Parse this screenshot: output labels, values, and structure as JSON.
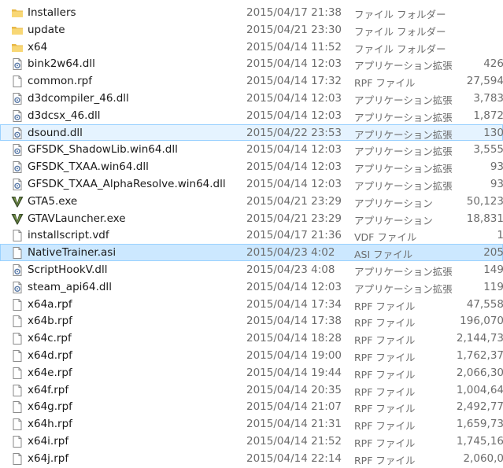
{
  "files": [
    {
      "name": "Installers",
      "date": "2015/04/17 21:38",
      "type": "ファイル フォルダー",
      "size": "",
      "icon": "folder-icon"
    },
    {
      "name": "update",
      "date": "2015/04/21 23:30",
      "type": "ファイル フォルダー",
      "size": "",
      "icon": "folder-icon"
    },
    {
      "name": "x64",
      "date": "2015/04/14 11:52",
      "type": "ファイル フォルダー",
      "size": "",
      "icon": "folder-icon"
    },
    {
      "name": "bink2w64.dll",
      "date": "2015/04/14 12:03",
      "type": "アプリケーション拡張",
      "size": "426",
      "icon": "dll-icon"
    },
    {
      "name": "common.rpf",
      "date": "2015/04/14 17:32",
      "type": "RPF ファイル",
      "size": "27,594",
      "icon": "file-icon"
    },
    {
      "name": "d3dcompiler_46.dll",
      "date": "2015/04/14 12:03",
      "type": "アプリケーション拡張",
      "size": "3,783",
      "icon": "dll-icon"
    },
    {
      "name": "d3dcsx_46.dll",
      "date": "2015/04/14 12:03",
      "type": "アプリケーション拡張",
      "size": "1,872",
      "icon": "dll-icon"
    },
    {
      "name": "dsound.dll",
      "date": "2015/04/22 23:53",
      "type": "アプリケーション拡張",
      "size": "130",
      "icon": "dll-icon",
      "state": "hot"
    },
    {
      "name": "GFSDK_ShadowLib.win64.dll",
      "date": "2015/04/14 12:03",
      "type": "アプリケーション拡張",
      "size": "3,555",
      "icon": "dll-icon"
    },
    {
      "name": "GFSDK_TXAA.win64.dll",
      "date": "2015/04/14 12:03",
      "type": "アプリケーション拡張",
      "size": "93",
      "icon": "dll-icon"
    },
    {
      "name": "GFSDK_TXAA_AlphaResolve.win64.dll",
      "date": "2015/04/14 12:03",
      "type": "アプリケーション拡張",
      "size": "93",
      "icon": "dll-icon"
    },
    {
      "name": "GTA5.exe",
      "date": "2015/04/21 23:29",
      "type": "アプリケーション",
      "size": "50,123",
      "icon": "gta-v-icon"
    },
    {
      "name": "GTAVLauncher.exe",
      "date": "2015/04/21 23:29",
      "type": "アプリケーション",
      "size": "18,831",
      "icon": "gta-v-icon"
    },
    {
      "name": "installscript.vdf",
      "date": "2015/04/17 21:36",
      "type": "VDF ファイル",
      "size": "1",
      "icon": "file-icon"
    },
    {
      "name": "NativeTrainer.asi",
      "date": "2015/04/23 4:02",
      "type": "ASI ファイル",
      "size": "205",
      "icon": "file-icon",
      "state": "sel"
    },
    {
      "name": "ScriptHookV.dll",
      "date": "2015/04/23 4:08",
      "type": "アプリケーション拡張",
      "size": "149",
      "icon": "dll-icon"
    },
    {
      "name": "steam_api64.dll",
      "date": "2015/04/14 12:03",
      "type": "アプリケーション拡張",
      "size": "119",
      "icon": "dll-icon"
    },
    {
      "name": "x64a.rpf",
      "date": "2015/04/14 17:34",
      "type": "RPF ファイル",
      "size": "47,558",
      "icon": "file-icon"
    },
    {
      "name": "x64b.rpf",
      "date": "2015/04/14 17:38",
      "type": "RPF ファイル",
      "size": "196,070",
      "icon": "file-icon"
    },
    {
      "name": "x64c.rpf",
      "date": "2015/04/14 18:28",
      "type": "RPF ファイル",
      "size": "2,144,73",
      "icon": "file-icon"
    },
    {
      "name": "x64d.rpf",
      "date": "2015/04/14 19:00",
      "type": "RPF ファイル",
      "size": "1,762,37",
      "icon": "file-icon"
    },
    {
      "name": "x64e.rpf",
      "date": "2015/04/14 19:44",
      "type": "RPF ファイル",
      "size": "2,066,30",
      "icon": "file-icon"
    },
    {
      "name": "x64f.rpf",
      "date": "2015/04/14 20:35",
      "type": "RPF ファイル",
      "size": "1,004,64",
      "icon": "file-icon"
    },
    {
      "name": "x64g.rpf",
      "date": "2015/04/14 21:07",
      "type": "RPF ファイル",
      "size": "2,492,77",
      "icon": "file-icon"
    },
    {
      "name": "x64h.rpf",
      "date": "2015/04/14 21:31",
      "type": "RPF ファイル",
      "size": "1,659,73",
      "icon": "file-icon"
    },
    {
      "name": "x64i.rpf",
      "date": "2015/04/14 21:52",
      "type": "RPF ファイル",
      "size": "1,745,16",
      "icon": "file-icon"
    },
    {
      "name": "x64j.rpf",
      "date": "2015/04/14 22:14",
      "type": "RPF ファイル",
      "size": "2,060,0",
      "icon": "file-icon"
    }
  ]
}
